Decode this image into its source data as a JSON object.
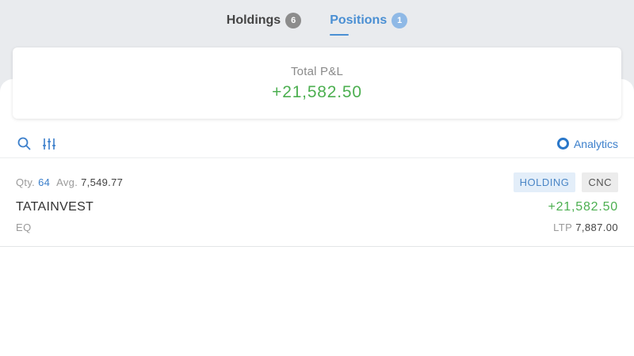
{
  "tabs": [
    {
      "label": "Holdings",
      "count": "6",
      "active": false
    },
    {
      "label": "Positions",
      "count": "1",
      "active": true
    }
  ],
  "summary": {
    "label": "Total P&L",
    "value": "+21,582.50"
  },
  "toolbar": {
    "search_icon": "search-icon",
    "filter_icon": "sliders-icon",
    "analytics_label": "Analytics"
  },
  "positions": [
    {
      "qty_label": "Qty.",
      "qty": "64",
      "avg_label": "Avg.",
      "avg": "7,549.77",
      "tags": [
        "HOLDING",
        "CNC"
      ],
      "symbol": "TATAINVEST",
      "pnl": "+21,582.50",
      "exchange": "EQ",
      "ltp_label": "LTP",
      "ltp": "7,887.00"
    }
  ],
  "colors": {
    "accent": "#4a8fd3",
    "profit": "#4caf50",
    "background": "#e9ebee"
  }
}
